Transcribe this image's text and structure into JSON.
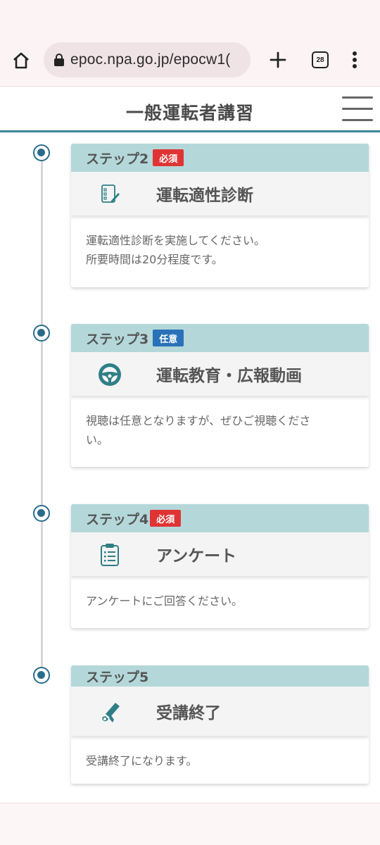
{
  "browser": {
    "url": "epoc.npa.go.jp/epocw1(",
    "tab_count": "28"
  },
  "header": {
    "title": "一般運転者講習"
  },
  "steps": [
    {
      "label": "ステップ2",
      "badge": "必須",
      "badge_kind": "required",
      "title": "運転適性診断",
      "icon": "checklist-edit-icon",
      "desc_lines": [
        "運転適性診断を実施してください。",
        "所要時間は20分程度です。"
      ]
    },
    {
      "label": "ステップ3",
      "badge": "任意",
      "badge_kind": "optional",
      "title": "運転教育・広報動画",
      "icon": "steering-wheel-icon",
      "desc_lines": [
        "視聴は任意となりますが、ぜひご視聴くださ",
        "い。"
      ]
    },
    {
      "label": "ステップ4",
      "badge": "必須",
      "badge_kind": "required",
      "title": "アンケート",
      "icon": "clipboard-list-icon",
      "desc_lines": [
        "アンケートにご回答ください。"
      ]
    },
    {
      "label": "ステップ5",
      "badge": "",
      "badge_kind": "none",
      "title": "受講終了",
      "icon": "diploma-scroll-icon",
      "desc_lines": [
        "受講終了になります。"
      ]
    }
  ],
  "colors": {
    "accent": "#3a8896",
    "step_header": "#b4d8da",
    "timeline_dot": "#2a6c8c",
    "badge_required": "#e03434",
    "badge_optional": "#2a72b8",
    "icon_teal": "#2f7f86"
  }
}
